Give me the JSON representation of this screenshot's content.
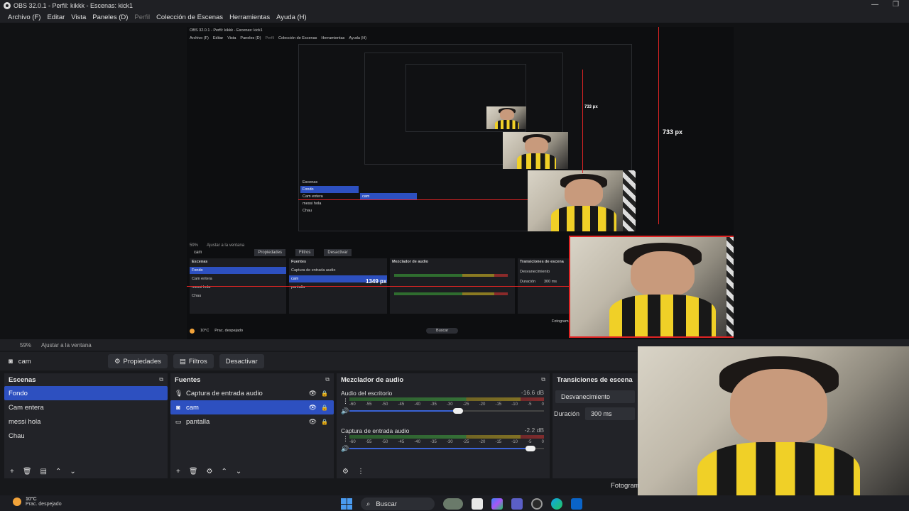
{
  "window": {
    "title": "OBS 32.0.1 - Perfil: kikkk - Escenas: kick1",
    "controls": [
      "—",
      "❐"
    ]
  },
  "menu": {
    "items": [
      "Archivo (F)",
      "Editar",
      "Vista",
      "Paneles (D)",
      "Perfil",
      "Colección de Escenas",
      "Herramientas",
      "Ayuda (H)"
    ],
    "disabled_item": "Perfil"
  },
  "preview": {
    "measure_vertical": "733 px",
    "measure_inner": "733 px",
    "measure_horizontal": "1349 px",
    "inner_title": "OBS 32.0.1 - Perfil: kikkk - Escenas: kick1",
    "inner_menu": [
      "Archivo (F)",
      "Editar",
      "Vista",
      "Paneles (D)",
      "Perfil",
      "Colección de Escenas",
      "Herramientas",
      "Ayuda (H)"
    ],
    "inner_toolbar": {
      "source": "cam",
      "props": "Propiedades",
      "filters": "Filtros",
      "deactivate": "Desactivar"
    },
    "inner_scenes_header": "Escenas",
    "inner_sources_header": "Fuentes",
    "inner_mixer_header": "Mezclador de audio",
    "inner_transitions_header": "Transiciones de escena",
    "inner_scenes": [
      "Fondo",
      "Cam entera",
      "messi hola",
      "Chau"
    ],
    "inner_sources": [
      "Captura de entrada audio",
      "cam",
      "pantalla"
    ],
    "inner_transition": "Desvanecimiento",
    "inner_duration": "Duración",
    "inner_duration_val": "300 ms",
    "inner_zoom": "59%",
    "inner_fit": "Ajustar a la ventana",
    "inner_weather_temp": "10°C",
    "inner_weather_desc": "Prac. despejado",
    "inner_search": "Buscar",
    "inner_fotogram": "Fotogram"
  },
  "zoombar": {
    "zoom": "59%",
    "fit": "Ajustar a la ventana"
  },
  "toolbar": {
    "source_name": "cam",
    "properties": "Propiedades",
    "filters": "Filtros",
    "deactivate": "Desactivar"
  },
  "scenes": {
    "header": "Escenas",
    "items": [
      "Fondo",
      "Cam entera",
      "messi hola",
      "Chau"
    ],
    "selected": 0
  },
  "sources": {
    "header": "Fuentes",
    "items": [
      {
        "name": "Captura de entrada audio",
        "icon": "microphone-icon"
      },
      {
        "name": "cam",
        "icon": "camera-icon"
      },
      {
        "name": "pantalla",
        "icon": "display-icon"
      }
    ],
    "selected": 1
  },
  "mixer": {
    "header": "Mezclador de audio",
    "tracks": [
      {
        "name": "Audio del escritorio",
        "db": "-16.6 dB",
        "volume": 0.56
      },
      {
        "name": "Captura de entrada audio",
        "db": "-2.2 dB",
        "volume": 0.93
      }
    ],
    "tick_labels": [
      "-60",
      "-55",
      "-50",
      "-45",
      "-40",
      "-35",
      "-30",
      "-25",
      "-20",
      "-15",
      "-10",
      "-5",
      "0"
    ]
  },
  "transitions": {
    "header": "Transiciones de escena",
    "selected": "Desvanecimiento",
    "duration_label": "Duración",
    "duration_value": "300 ms"
  },
  "status": {
    "fotogram": "Fotogram"
  },
  "taskbar": {
    "temperature": "10°C",
    "weather": "Prac. despejado",
    "search": "Buscar"
  },
  "colors": {
    "selection": "#2d50c0",
    "measure_line": "#e02424",
    "panel": "#222328",
    "background": "#17181b"
  }
}
